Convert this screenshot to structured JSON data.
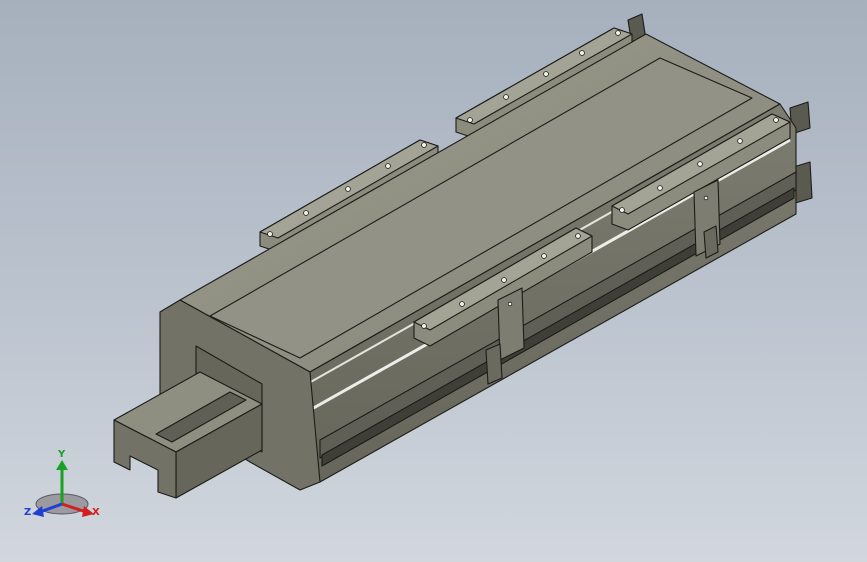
{
  "triad": {
    "x_label": "X",
    "y_label": "Y",
    "z_label": "Z",
    "colors": {
      "x": "#d21f1f",
      "y": "#1aa024",
      "z": "#1f3fd2"
    }
  },
  "model": {
    "colors": {
      "top": "#8e8e81",
      "side": "#77776b",
      "front": "#6f6f63",
      "dark": "#5d5d52",
      "edge": "#1c1c18",
      "highlight": "#e9e9e3",
      "hole": "#f2f2ee"
    }
  }
}
